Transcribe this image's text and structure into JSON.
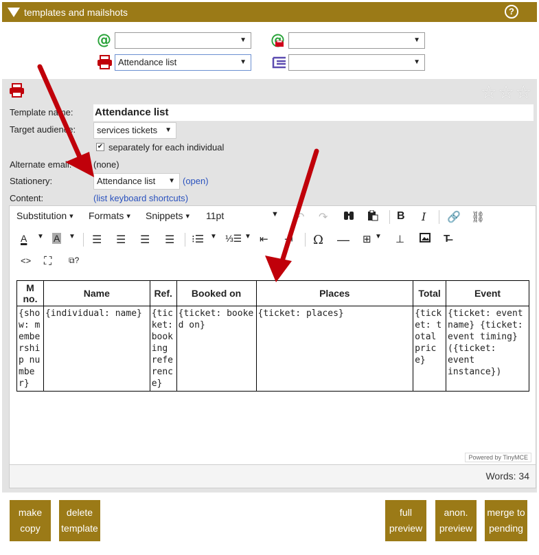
{
  "window": {
    "title": "templates and mailshots",
    "help_icon": "?"
  },
  "top_selects": {
    "email_select_1": "",
    "email_select_2": "",
    "print_select": "Attendance list",
    "list_select": ""
  },
  "stars": "☆☆☆",
  "form": {
    "template_name_label": "Template name:",
    "template_name_value": "Attendance list",
    "target_audience_label": "Target audience:",
    "target_audience_value": "services tickets",
    "separately_label": "separately for each individual",
    "alternate_email_label": "Alternate email:",
    "alternate_email_value": "(none)",
    "stationery_label": "Stationery:",
    "stationery_value": "Attendance list",
    "stationery_open": "(open)",
    "content_label": "Content:",
    "content_link_open": "(",
    "content_link": "list keyboard shortcuts",
    "content_link_close": ")"
  },
  "toolbar": {
    "substitution": "Substitution",
    "formats": "Formats",
    "snippets": "Snippets",
    "font_size": "11pt",
    "bold": "B",
    "italic": "I",
    "text_color": "A",
    "bg_color": "A",
    "omega": "Ω",
    "source": "<>"
  },
  "table": {
    "headers": [
      "M no.",
      "Name",
      "Ref.",
      "Booked on",
      "Places",
      "Total",
      "Event"
    ],
    "row": [
      "{show: membership number}",
      "{individual: name}",
      "{ticket: booking reference}",
      "{ticket: booked on}",
      "{ticket: places}",
      "{ticket: total price}",
      "{ticket: event name} {ticket: event timing} ({ticket: event instance})"
    ]
  },
  "editor": {
    "powered_by": "Powered by TinyMCE",
    "word_count": "Words: 34"
  },
  "buttons": {
    "make_copy": [
      "make",
      "copy"
    ],
    "delete_template": [
      "delete",
      "template"
    ],
    "full_preview": [
      "full",
      "preview"
    ],
    "anon_preview": [
      "anon.",
      "preview"
    ],
    "merge_to_pending": [
      "merge to",
      "pending"
    ]
  },
  "colors": {
    "brand": "#9b7a17",
    "panel": "#e3e3e3",
    "link": "#2a52be",
    "arrow": "#c0000a"
  }
}
